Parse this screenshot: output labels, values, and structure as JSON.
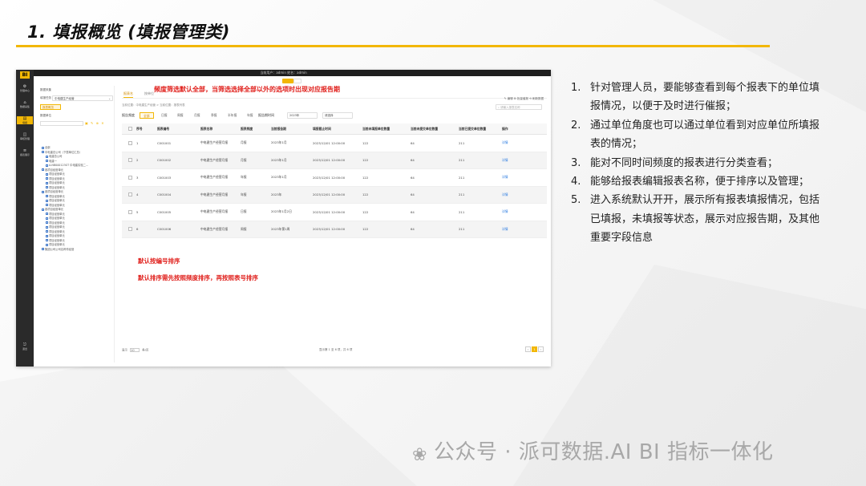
{
  "slide": {
    "title": "1. 填报概览 (填报管理类)",
    "notes": [
      {
        "num": "1.",
        "text": "针对管理人员，要能够查看到每个报表下的单位填报情况，以便于及时进行催报；"
      },
      {
        "num": "2.",
        "text": "通过单位角度也可以通过单位看到对应单位所填报表的情况；"
      },
      {
        "num": "3.",
        "text": "能对不同时间频度的报表进行分类查看；"
      },
      {
        "num": "4.",
        "text": "能够给报表编辑报表名称，便于排序以及管理；"
      },
      {
        "num": "5.",
        "text": "进入系统默认开开，展示所有报表填报情况，包括已填报，未填报等状态，展示对应报告期，及其他重要字段信息"
      }
    ],
    "watermark": "公众号 · 派可数据.AI BI 指标一体化",
    "watermark_icon": "wechat-icon"
  },
  "app": {
    "topbar_text": "当前用户：admin  姓名：admin",
    "logo": "BI",
    "sidebar": [
      {
        "icon": "⚙",
        "label": "管理中心"
      },
      {
        "icon": "⌂",
        "label": "数据采集"
      },
      {
        "icon": "▤",
        "label": "填报",
        "active": true
      },
      {
        "icon": "◫",
        "label": "审核管理"
      },
      {
        "icon": "≡",
        "label": "报表展示"
      },
      {
        "icon": "⎋",
        "label": "退出"
      }
    ],
    "tree": {
      "label1": "数据采集",
      "label2": "填报任务",
      "select": "中电建生产经营",
      "button": "报表概览",
      "label3": "数据单位",
      "tools": "▣ ✎ ⊕ ✕",
      "nodes": [
        {
          "indent": 0,
          "text": "全部"
        },
        {
          "indent": 0,
          "text": "中电建总公司（下属单位汇总）"
        },
        {
          "indent": 1,
          "text": "电建总公司"
        },
        {
          "indent": 1,
          "text": "电建一"
        },
        {
          "indent": 1,
          "text": "A-NB000123GT 中电建实验二..."
        },
        {
          "indent": 0,
          "text": "各项目经营单元"
        },
        {
          "indent": 1,
          "text": "项目经营单元"
        },
        {
          "indent": 1,
          "text": "项目经营单元"
        },
        {
          "indent": 1,
          "text": "项目经营单元"
        },
        {
          "indent": 1,
          "text": "项目经营单元"
        },
        {
          "indent": 0,
          "text": "各项目经营单元"
        },
        {
          "indent": 1,
          "text": "项目经营单元"
        },
        {
          "indent": 1,
          "text": "项目经营单元"
        },
        {
          "indent": 1,
          "text": "项目经营单元"
        },
        {
          "indent": 0,
          "text": "各项目经营单元"
        },
        {
          "indent": 1,
          "text": "项目经营单元"
        },
        {
          "indent": 1,
          "text": "项目经营单元"
        },
        {
          "indent": 1,
          "text": "项目经营单元"
        },
        {
          "indent": 1,
          "text": "项目经营单元"
        },
        {
          "indent": 1,
          "text": "项目经营单元"
        },
        {
          "indent": 1,
          "text": "项目经营单元"
        },
        {
          "indent": 1,
          "text": "项目经营单元"
        },
        {
          "indent": 1,
          "text": "项目经营单元"
        },
        {
          "indent": 0,
          "text": "集团公司公司名称作经营"
        }
      ]
    },
    "tabs": [
      "报表名",
      "按单位"
    ],
    "toolbar_icons": "✎ 编辑  ⊞ 批量催报  ⟲ 刷新数据",
    "breadcrumb": "当前位置：中电建生产经营 > 当前位置：报表列表",
    "search_placeholder": "请输入报表名称",
    "filter": {
      "label": "报告频度",
      "chips": [
        "全部",
        "日报",
        "周报",
        "月报",
        "季报",
        "半年报",
        "年报"
      ],
      "period_label": "报告期时间",
      "period_value": "2023年",
      "unit_value": "请选择"
    },
    "table": {
      "headers": [
        "序号",
        "报表编号",
        "报表名称",
        "报表频度",
        "当前报告期",
        "填报截止时间",
        "当前未填报单位数量",
        "当前未提交单位数量",
        "当前已提交单位数量",
        "操作"
      ],
      "rows": [
        [
          "1",
          "C001001",
          "中电建生产经营月报",
          "月报",
          "2023年1月",
          "2023/12/01 12:00:00",
          "122",
          "64",
          "211",
          "详情"
        ],
        [
          "2",
          "C001002",
          "中电建生产经营月报",
          "月报",
          "2023年1月",
          "2023/12/01 12:00:00",
          "122",
          "64",
          "211",
          "详情"
        ],
        [
          "3",
          "C001003",
          "中电建生产经营月报",
          "年报",
          "2023年1月",
          "2023/12/01 12:00:00",
          "122",
          "64",
          "211",
          "详情"
        ],
        [
          "4",
          "C001004",
          "中电建生产经营月报",
          "年报",
          "2023年",
          "2023/12/01 12:00:00",
          "122",
          "64",
          "211",
          "详情"
        ],
        [
          "5",
          "C001005",
          "中电建生产经营月报",
          "日报",
          "2023年1月2日",
          "2023/12/01 12:00:00",
          "122",
          "64",
          "211",
          "详情"
        ],
        [
          "6",
          "C001006",
          "中电建生产经营月报",
          "周报",
          "2023年第1周",
          "2023/12/01 12:00:00",
          "122",
          "64",
          "211",
          "详情"
        ]
      ]
    },
    "annotations": {
      "a1": "频度筛选默认全部，当筛选选择全部以外的选项时出现对应报告期",
      "a2": "默认按编号排序",
      "a3": "默认排序需先按照频度排序，再按照表号排序"
    },
    "footer": {
      "left_a": "显示",
      "left_sel": "10",
      "left_b": "条/页",
      "center": "显示第 1 至 6 项，共 6 项",
      "pages": [
        "‹",
        "1",
        "›"
      ]
    }
  }
}
